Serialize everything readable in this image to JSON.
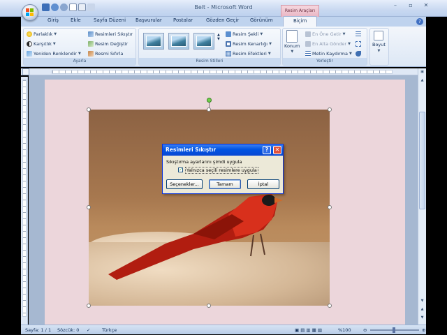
{
  "window": {
    "title": "Belt - Microsoft Word",
    "context_tab_group": "Resim Araçları"
  },
  "tabs": [
    "Giriş",
    "Ekle",
    "Sayfa Düzeni",
    "Başvurular",
    "Postalar",
    "Gözden Geçir",
    "Görünüm",
    "Biçim"
  ],
  "active_tab": "Biçim",
  "ribbon": {
    "ayarla": {
      "label": "Ayarla",
      "items": [
        "Parlaklık",
        "Karşıtlık",
        "Yeniden Renklendir",
        "Resimleri Sıkıştır",
        "Resim Değiştir",
        "Resmi Sıfırla"
      ]
    },
    "resim_stilleri": {
      "label": "Resim Stilleri",
      "items": [
        "Resim Şekli",
        "Resim Kenarlığı",
        "Resim Efektleri"
      ]
    },
    "yerlestir": {
      "label": "Yerleştir",
      "konum": "Konum",
      "items": [
        "En Öne Getir",
        "En Alta Gönder",
        "Metin Kaydırma"
      ]
    },
    "boyut": {
      "label": "Boyut"
    }
  },
  "dialog": {
    "title": "Resimleri Sıkıştır",
    "question_btn": "?",
    "close_btn": "✕",
    "label": "Sıkıştırma ayarlarını şimdi uygula",
    "checkbox_label": "Yalnızca seçili resimlere uygula",
    "checkbox_checked": true,
    "buttons": [
      "Seçenekler...",
      "Tamam",
      "İptal"
    ]
  },
  "statusbar": {
    "page": "Sayfa: 1 / 1",
    "words": "Sözcük: 0",
    "language": "Türkçe",
    "zoom": "%100"
  },
  "colors": {
    "ribbon_bg": "#dce7f5",
    "document_page": "#ecd6db",
    "dialog_title": "#0054e3",
    "context_tab": "#e9b6c4"
  }
}
